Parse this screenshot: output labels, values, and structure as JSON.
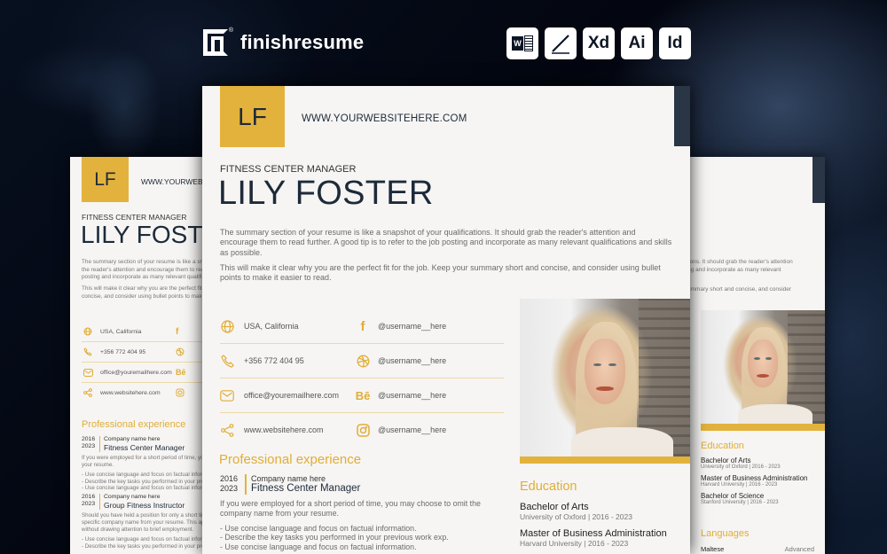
{
  "brand": {
    "name": "finishresume",
    "registered": "®"
  },
  "formats": [
    {
      "icon": "word-icon",
      "label": "W"
    },
    {
      "icon": "pen-icon",
      "label": ""
    },
    {
      "icon": "xd-icon",
      "label": "Xd"
    },
    {
      "icon": "ai-icon",
      "label": "Ai"
    },
    {
      "icon": "id-icon",
      "label": "Id"
    }
  ],
  "colors": {
    "accent": "#e3b23c",
    "ink": "#1d2a3a",
    "strip": "#2a3646"
  },
  "resume": {
    "monogram": "LF",
    "website_header": "WWW.YOURWEBSITEHERE.COM",
    "job_title": "FITNESS CENTER MANAGER",
    "name": "LILY FOSTER",
    "summary_p1": "The summary section of your resume is like a snapshot of your qualifications. It should grab the reader's attention and encourage them to read further. A good tip is to refer to the job posting and incorporate as many relevant qualifications and skills as possible.",
    "summary_p2": "This will make it clear why you are the perfect fit for the job. Keep your summary short and concise, and consider using bullet points to make it easier to read.",
    "contacts": [
      {
        "icon": "globe-icon",
        "text": "USA, California",
        "social_icon": "facebook-icon",
        "social_text": "@username__here"
      },
      {
        "icon": "phone-icon",
        "text": "+356 772 404 95",
        "social_icon": "dribbble-icon",
        "social_text": "@username__here"
      },
      {
        "icon": "mail-icon",
        "text": "office@youremailhere.com",
        "social_icon": "behance-icon",
        "social_text": "@username__here"
      },
      {
        "icon": "share-icon",
        "text": "www.websitehere.com",
        "social_icon": "instagram-icon",
        "social_text": "@username__here"
      }
    ],
    "experience_heading": "Professional experience",
    "experience": [
      {
        "start": "2016",
        "end": "2023",
        "company": "Company name here",
        "role": "Fitness Center Manager",
        "description": "If you were employed for a short period of time, you may choose to omit the company name from your resume.",
        "bullets": [
          "- Use concise language and focus on factual information.",
          "- Describe the key tasks you performed in your previous work exp.",
          "- Use concise language and focus on factual information."
        ]
      },
      {
        "start": "2016",
        "end": "2023",
        "company": "Company name here",
        "role": "Group Fitness Instructor",
        "description": "Should you have held a position for only a short time, consider the possibility of leaving out the specific company name from your resume. This approach can help you focus on your experiences without drawing attention to brief employment.",
        "bullets": [
          "- Use concise language and focus on factual information.",
          "- Describe the key tasks you performed in your previous work exp."
        ]
      }
    ],
    "education_heading": "Education",
    "education": [
      {
        "degree": "Bachelor of Arts",
        "detail": "University of Oxford | 2016 - 2023"
      },
      {
        "degree": "Master of Business Administration",
        "detail": "Harvard University | 2016 - 2023"
      },
      {
        "degree": "Bachelor of Science",
        "detail": "Stanford University | 2016 - 2023"
      }
    ],
    "languages_heading": "Languages",
    "languages": [
      {
        "name": "Maltese",
        "level": "Advanced"
      }
    ]
  }
}
